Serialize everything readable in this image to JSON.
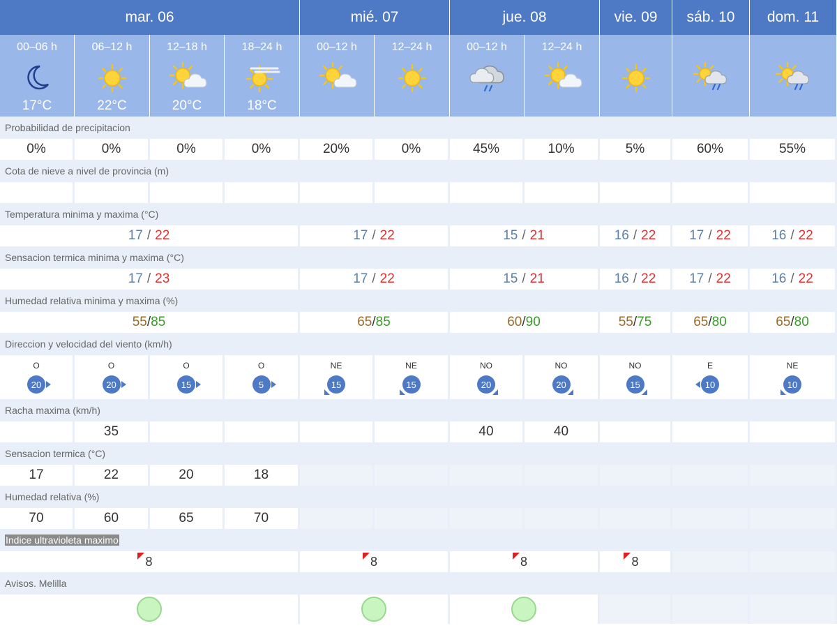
{
  "days": [
    {
      "label": "mar. 06",
      "periods": 4
    },
    {
      "label": "mié. 07",
      "periods": 2
    },
    {
      "label": "jue. 08",
      "periods": 2
    },
    {
      "label": "vie. 09",
      "periods": 1
    },
    {
      "label": "sáb. 10",
      "periods": 1
    },
    {
      "label": "dom. 11",
      "periods": 1
    }
  ],
  "periods": [
    {
      "label": "00–06 h",
      "icon": "moon-icon",
      "temp": "17°C"
    },
    {
      "label": "06–12 h",
      "icon": "sun-icon",
      "temp": "22°C"
    },
    {
      "label": "12–18 h",
      "icon": "sun-cloud-icon",
      "temp": "20°C"
    },
    {
      "label": "18–24 h",
      "icon": "sun-haze-icon",
      "temp": "18°C"
    },
    {
      "label": "00–12 h",
      "icon": "sun-cloud-icon",
      "temp": ""
    },
    {
      "label": "12–24 h",
      "icon": "sun-icon",
      "temp": ""
    },
    {
      "label": "00–12 h",
      "icon": "cloud-rain-icon",
      "temp": ""
    },
    {
      "label": "12–24 h",
      "icon": "sun-cloud-icon",
      "temp": ""
    },
    {
      "label": "",
      "icon": "sun-icon",
      "temp": ""
    },
    {
      "label": "",
      "icon": "sun-cloud-rain-icon",
      "temp": ""
    },
    {
      "label": "",
      "icon": "sun-cloud-rain-icon",
      "temp": ""
    }
  ],
  "rows": {
    "precip": {
      "label": "Probabilidad de precipitacion",
      "values": [
        "0%",
        "0%",
        "0%",
        "0%",
        "20%",
        "0%",
        "45%",
        "10%",
        "5%",
        "60%",
        "55%"
      ]
    },
    "snow": {
      "label": "Cota de nieve a nivel de provincia (m)",
      "values": [
        "",
        "",
        "",
        "",
        "",
        "",
        "",
        "",
        "",
        "",
        ""
      ]
    },
    "temp": {
      "label": "Temperatura minima y maxima (°C)",
      "values": [
        {
          "min": "17",
          "max": "22"
        },
        {
          "min": "17",
          "max": "22"
        },
        {
          "min": "15",
          "max": "21"
        },
        {
          "min": "16",
          "max": "22"
        },
        {
          "min": "17",
          "max": "22"
        },
        {
          "min": "16",
          "max": "22"
        }
      ]
    },
    "feels": {
      "label": "Sensacion termica minima y maxima (°C)",
      "values": [
        {
          "min": "17",
          "max": "23"
        },
        {
          "min": "17",
          "max": "22"
        },
        {
          "min": "15",
          "max": "21"
        },
        {
          "min": "16",
          "max": "22"
        },
        {
          "min": "17",
          "max": "22"
        },
        {
          "min": "16",
          "max": "22"
        }
      ]
    },
    "humidity": {
      "label": "Humedad relativa minima y maxima (%)",
      "values": [
        {
          "min": "55",
          "max": "85"
        },
        {
          "min": "65",
          "max": "85"
        },
        {
          "min": "60",
          "max": "90"
        },
        {
          "min": "55",
          "max": "75"
        },
        {
          "min": "65",
          "max": "80"
        },
        {
          "min": "65",
          "max": "80"
        }
      ]
    },
    "wind": {
      "label": "Direccion y velocidad del viento (km/h)",
      "values": [
        {
          "dir": "O",
          "speed": "20",
          "arrow": "right"
        },
        {
          "dir": "O",
          "speed": "20",
          "arrow": "right"
        },
        {
          "dir": "O",
          "speed": "15",
          "arrow": "right"
        },
        {
          "dir": "O",
          "speed": "5",
          "arrow": "right"
        },
        {
          "dir": "NE",
          "speed": "15",
          "arrow": "sw"
        },
        {
          "dir": "NE",
          "speed": "15",
          "arrow": "sw"
        },
        {
          "dir": "NO",
          "speed": "20",
          "arrow": "se"
        },
        {
          "dir": "NO",
          "speed": "20",
          "arrow": "se"
        },
        {
          "dir": "NO",
          "speed": "15",
          "arrow": "se"
        },
        {
          "dir": "E",
          "speed": "10",
          "arrow": "left"
        },
        {
          "dir": "NE",
          "speed": "10",
          "arrow": "sw"
        }
      ]
    },
    "gust": {
      "label": "Racha maxima (km/h)",
      "values": [
        "",
        "35",
        "",
        "",
        "",
        "",
        "40",
        "40",
        "",
        "",
        ""
      ]
    },
    "feels_hourly": {
      "label": "Sensacion termica (°C)",
      "values": [
        "17",
        "22",
        "20",
        "18",
        null,
        null,
        null,
        null,
        null,
        null,
        null
      ]
    },
    "humidity_hourly": {
      "label": "Humedad relativa (%)",
      "values": [
        "70",
        "60",
        "65",
        "70",
        null,
        null,
        null,
        null,
        null,
        null,
        null
      ]
    },
    "uv": {
      "label": "Indice ultravioleta maximo",
      "values": [
        "8",
        "8",
        "8",
        "8",
        null,
        null
      ]
    },
    "warnings": {
      "label": "Avisos. Melilla",
      "values": [
        "green",
        "green",
        "green",
        null,
        null,
        null
      ]
    }
  },
  "colors": {
    "header": "#4e79c4",
    "subheader": "#9ab7ea",
    "label_bg": "#e8eff8",
    "temp_min": "#5a7fa8",
    "temp_max": "#e03030",
    "hum_min": "#9a6a2a",
    "hum_max": "#3a9a2a",
    "wind_badge": "#4e79c4",
    "uv_flag": "#e02020",
    "warning_green": "#c8f5c0"
  }
}
